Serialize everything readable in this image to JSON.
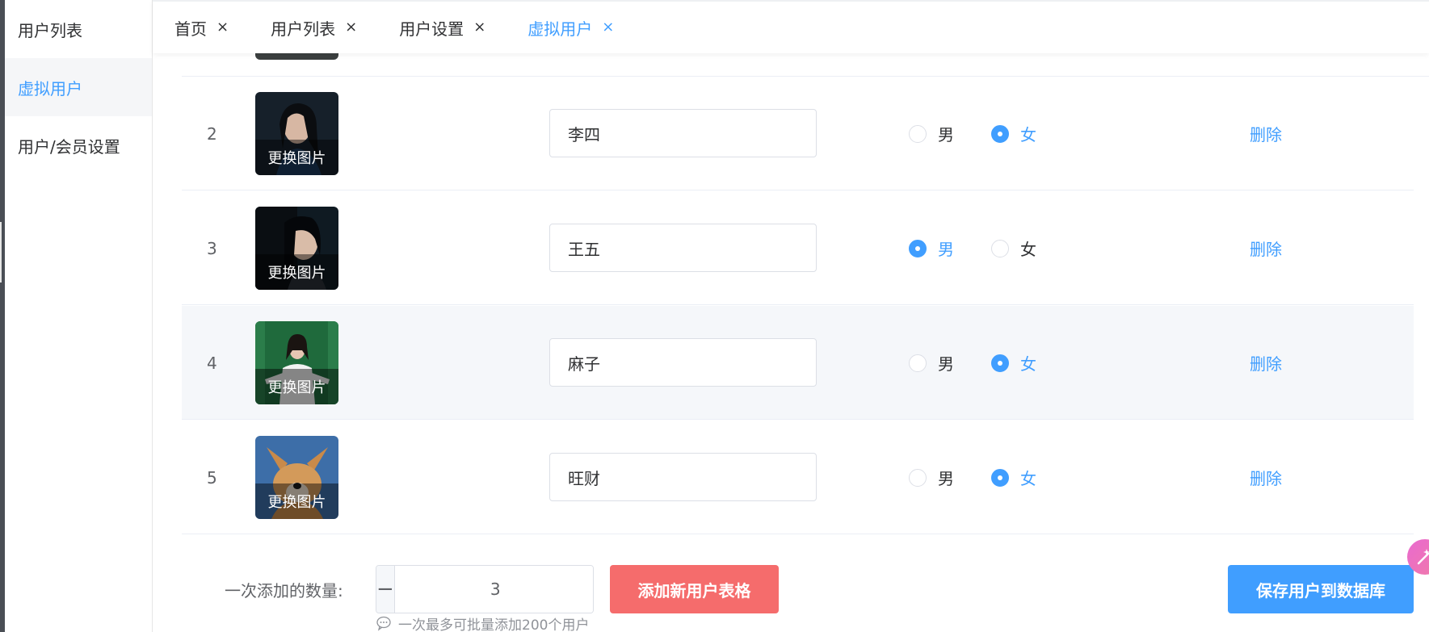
{
  "sidebar": {
    "items": [
      {
        "label": "用户列表",
        "active": false
      },
      {
        "label": "虚拟用户",
        "active": true
      },
      {
        "label": "用户/会员设置",
        "active": false
      }
    ]
  },
  "tabs": [
    {
      "label": "首页",
      "close": "×",
      "active": false
    },
    {
      "label": "用户列表",
      "close": "×",
      "active": false
    },
    {
      "label": "用户设置",
      "close": "×",
      "active": false
    },
    {
      "label": "虚拟用户",
      "close": "×",
      "active": true
    }
  ],
  "table": {
    "change_image_label": "更换图片",
    "male_label": "男",
    "female_label": "女",
    "delete_label": "删除",
    "rows": [
      {
        "index": "2",
        "name": "李四",
        "gender": "female",
        "highlighted": false
      },
      {
        "index": "3",
        "name": "王五",
        "gender": "male",
        "highlighted": false
      },
      {
        "index": "4",
        "name": "麻子",
        "gender": "female",
        "highlighted": true
      },
      {
        "index": "5",
        "name": "旺财",
        "gender": "female",
        "highlighted": false
      }
    ]
  },
  "footer": {
    "quantity_label": "一次添加的数量:",
    "quantity_value": "3",
    "minus": "−",
    "plus": "+",
    "add_button": "添加新用户表格",
    "hint": "一次最多可批量添加200个用户",
    "save_button": "保存用户到数据库"
  },
  "colors": {
    "primary": "#409eff",
    "danger": "#f56c6c",
    "row_highlight": "#f5f7fa"
  }
}
